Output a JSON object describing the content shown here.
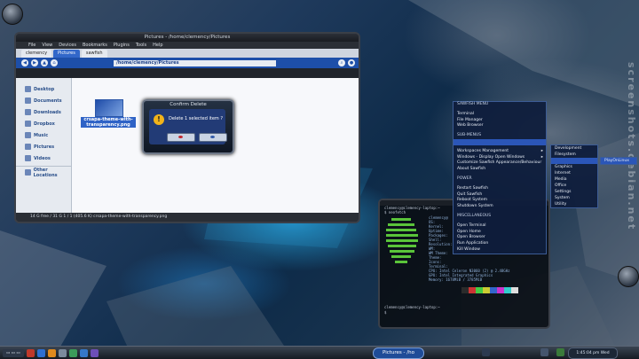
{
  "fm": {
    "title": "Pictures - /home/clemency/Pictures",
    "menu": [
      "File",
      "View",
      "Devices",
      "Bookmarks",
      "Plugins",
      "Tools",
      "Help"
    ],
    "tabs": [
      "clemency",
      "Pictures",
      "sawfish"
    ],
    "location": "/home/clemency/Pictures",
    "sidebar": [
      "Desktop",
      "Documents",
      "Downloads",
      "Dropbox",
      "Music",
      "Pictures",
      "Videos"
    ],
    "other_locations": "Other Locations",
    "file_label": "crsapa-theme-with-transparency.png",
    "status": "14 G free / 31 G  1 / 1 (405.6 K)   crsapa-theme-with-transparency.png"
  },
  "dialog": {
    "title": "Confirm Delete",
    "message": "Delete 1 selected item ?",
    "warn_glyph": "!"
  },
  "terminal": {
    "prompt": "clemency@clemency-laptop:~",
    "command": "$ neofetch",
    "user_host": "clemency@",
    "info": [
      "OS:",
      "Kernel:",
      "Uptime:",
      "Packages:",
      "Shell:",
      "Resolution:",
      "WM:",
      "WM Theme:",
      "Theme:",
      "Icons:",
      "Terminal:",
      "CPU: Intel Celeron N3060 (2) @ 2.48GHz",
      "GPU: Intel Integrated Graphics",
      "Memory: 1678MiB / 3785MiB"
    ],
    "prompt2": "clemency@clemency-laptop:~",
    "cursor": "$"
  },
  "menu": {
    "items": [
      {
        "label": "SAWFISH MENU",
        "kind": "hdr"
      },
      {
        "label": "",
        "kind": "sep"
      },
      {
        "label": "Terminal"
      },
      {
        "label": "File Manager"
      },
      {
        "label": "Web Browser"
      },
      {
        "label": "",
        "kind": "sep"
      },
      {
        "label": "SUB-MENUS",
        "kind": "hdr"
      },
      {
        "label": "",
        "kind": "hl"
      },
      {
        "label": "",
        "kind": "sep"
      },
      {
        "label": "Workspaces Management",
        "arrow": "▸"
      },
      {
        "label": "Windows - Display Open Windows",
        "arrow": "▸"
      },
      {
        "label": "Customize Sawfish Appearance/Behaviour"
      },
      {
        "label": "About Sawfish"
      },
      {
        "label": "",
        "kind": "sep"
      },
      {
        "label": "POWER",
        "kind": "hdr"
      },
      {
        "label": "",
        "kind": "sep"
      },
      {
        "label": "Restart Sawfish"
      },
      {
        "label": "Quit Sawfish"
      },
      {
        "label": "Reboot System"
      },
      {
        "label": "Shutdown System"
      },
      {
        "label": "",
        "kind": "sep"
      },
      {
        "label": "MISCELLANEOUS",
        "kind": "hdr"
      },
      {
        "label": "",
        "kind": "sep"
      },
      {
        "label": "Open Terminal"
      },
      {
        "label": "Open Home"
      },
      {
        "label": "Open Browser"
      },
      {
        "label": "Run Application"
      },
      {
        "label": "Kill Window"
      }
    ],
    "submenu": [
      "Development",
      "Filesystem",
      "",
      "Graphics",
      "Internet",
      "Media",
      "Office",
      "Settings",
      "System",
      "Utility"
    ],
    "sub2": "PlayOnLinux"
  },
  "taskbar": {
    "center_label": "Pictures - /ho",
    "clock": "1:45:04 pm Wed"
  },
  "watermark": "screenshots.debian.net",
  "colors": {
    "accent": "#2b56b8",
    "terminal_green": "#5ac43a",
    "warn": "#f1b31a"
  }
}
